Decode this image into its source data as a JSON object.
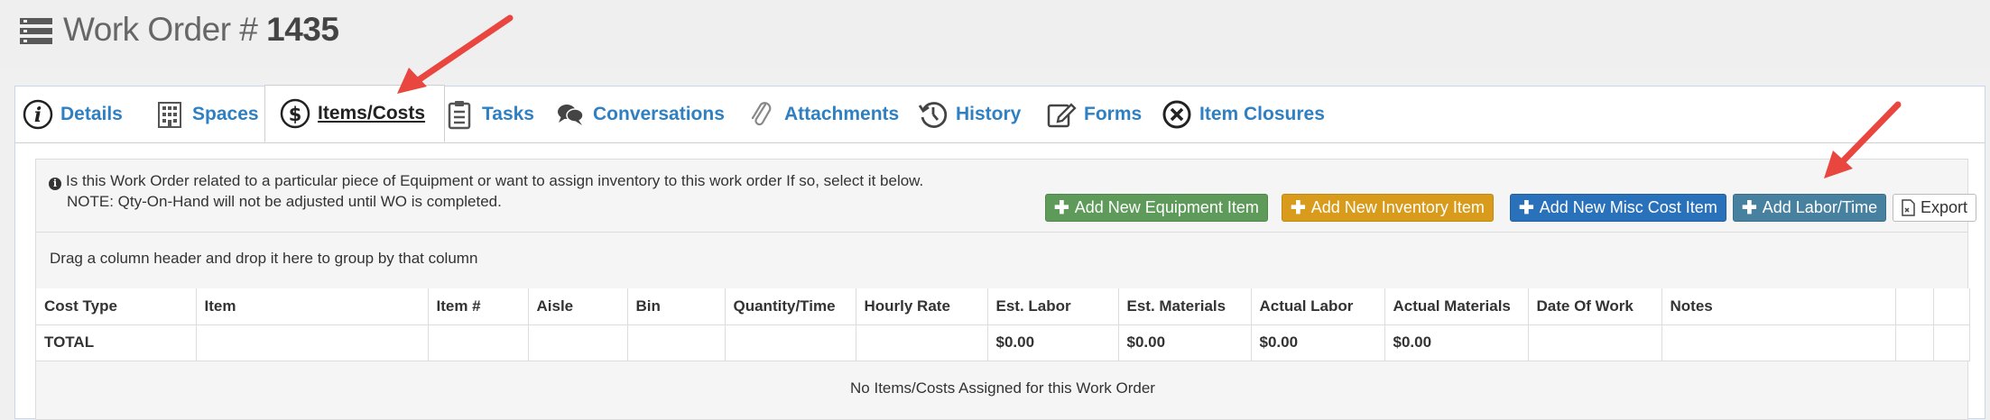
{
  "header": {
    "title_prefix": "Work Order # ",
    "title_number": "1435"
  },
  "tabs": [
    {
      "label": "Details",
      "icon": "info-icon"
    },
    {
      "label": "Spaces",
      "icon": "building-icon"
    },
    {
      "label": "Items/Costs",
      "icon": "dollar-icon",
      "active": true
    },
    {
      "label": "Tasks",
      "icon": "clipboard-icon"
    },
    {
      "label": "Conversations",
      "icon": "chat-icon"
    },
    {
      "label": "Attachments",
      "icon": "paperclip-icon"
    },
    {
      "label": "History",
      "icon": "history-icon"
    },
    {
      "label": "Forms",
      "icon": "edit-icon"
    },
    {
      "label": "Item Closures",
      "icon": "close-circle-icon"
    }
  ],
  "info": {
    "line1": "Is this Work Order related to a particular piece of Equipment or want to assign inventory to this work order If so, select it below.",
    "line2": "NOTE: Qty-On-Hand will not be adjusted until WO is completed."
  },
  "buttons": {
    "add_equipment": "Add New Equipment Item",
    "add_inventory": "Add New Inventory Item",
    "add_misc": "Add New Misc Cost Item",
    "add_labor": "Add Labor/Time",
    "export": "Export"
  },
  "group_bar": "Drag a column header and drop it here to group by that column",
  "table": {
    "columns": [
      "Cost Type",
      "Item",
      "Item #",
      "Aisle",
      "Bin",
      "Quantity/Time",
      "Hourly Rate",
      "Est. Labor",
      "Est. Materials",
      "Actual Labor",
      "Actual Materials",
      "Date Of Work",
      "Notes",
      "",
      ""
    ],
    "total_row": [
      "TOTAL",
      "",
      "",
      "",
      "",
      "",
      "",
      "$0.00",
      "$0.00",
      "$0.00",
      "$0.00",
      "",
      "",
      "",
      ""
    ],
    "empty_message": "No Items/Costs Assigned for this Work Order"
  },
  "colors": {
    "link": "#2f80c2",
    "green": "#5e9b5a",
    "orange": "#d89b1b",
    "blue": "#2a71bb",
    "teal": "#48819f",
    "arrow": "#e8463e"
  }
}
